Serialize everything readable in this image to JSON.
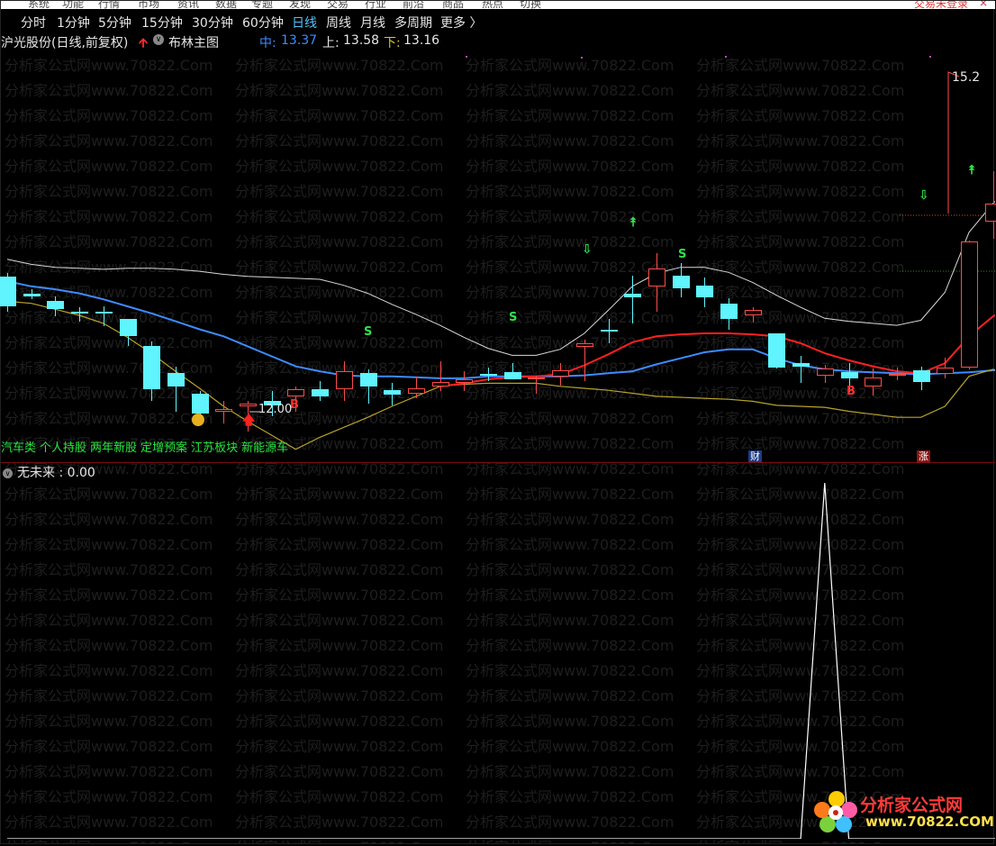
{
  "menu": [
    "系统",
    "功能",
    "行情",
    "市场",
    "资讯",
    "数据",
    "专题",
    "发现",
    "交易",
    "行业",
    "前沿",
    "商品",
    "热点",
    "切换"
  ],
  "login_status": "交易未登录",
  "close_label": "×",
  "periods": [
    {
      "label": "分时",
      "active": false
    },
    {
      "label": "1分钟",
      "active": false
    },
    {
      "label": "5分钟",
      "active": false
    },
    {
      "label": "15分钟",
      "active": false
    },
    {
      "label": "30分钟",
      "active": false
    },
    {
      "label": "60分钟",
      "active": false
    },
    {
      "label": "日线",
      "active": true
    },
    {
      "label": "周线",
      "active": false
    },
    {
      "label": "月线",
      "active": false
    },
    {
      "label": "多周期",
      "active": false
    },
    {
      "label": "更多 〉",
      "active": false
    }
  ],
  "info": {
    "stock_title": "沪光股份(日线,前复权)",
    "indicator_name": "布林主图",
    "mid_label": "中:",
    "mid_value": "13.37",
    "upper_label": "上:",
    "upper_value": "13.58",
    "lower_label": "下:",
    "lower_value": "13.16"
  },
  "price_annotations": {
    "low_price": "12.00",
    "high_price": "15.2"
  },
  "signal_marks": {
    "buy": "B",
    "sell": "S"
  },
  "concept_tags": [
    "汽车类",
    "个人持股",
    "两年新股",
    "定增预案",
    "江苏板块",
    "新能源车"
  ],
  "event_badges": {
    "finance": "财",
    "rise": "涨"
  },
  "sub_indicator": {
    "label": "无未来 : 0.00"
  },
  "watermark_text": "分析家公式网www.70822.Com",
  "logo": {
    "title": "分析家公式网",
    "url": "www.70822.COM"
  },
  "colors": {
    "up": "#ff4b4b",
    "down": "#5ff4ff",
    "mid_line": "#3d8cff",
    "upper_line": "#d9d9d9",
    "lower_line": "#b8a22a",
    "ma_red": "#ff2020",
    "active_period": "#4fc3ff"
  },
  "chart_data": {
    "type": "candlestick",
    "visible_price_labels": [
      "12.00",
      "15.2"
    ],
    "candles_ohlc": [
      [
        13.55,
        13.58,
        13.2,
        13.25
      ],
      [
        13.38,
        13.42,
        13.32,
        13.35
      ],
      [
        13.3,
        13.35,
        13.15,
        13.22
      ],
      [
        13.2,
        13.24,
        13.1,
        13.18
      ],
      [
        13.2,
        13.25,
        13.05,
        13.18
      ],
      [
        13.12,
        13.12,
        12.85,
        12.95
      ],
      [
        12.85,
        12.9,
        12.3,
        12.42
      ],
      [
        12.58,
        12.65,
        12.2,
        12.45
      ],
      [
        12.38,
        12.4,
        12.12,
        12.18
      ],
      [
        12.2,
        12.3,
        12.08,
        12.22
      ],
      [
        12.25,
        12.3,
        12.0,
        12.28
      ],
      [
        12.3,
        12.4,
        12.15,
        12.26
      ],
      [
        12.35,
        12.45,
        12.2,
        12.42
      ],
      [
        12.42,
        12.5,
        12.3,
        12.35
      ],
      [
        12.42,
        12.7,
        12.3,
        12.6
      ],
      [
        12.58,
        12.62,
        12.28,
        12.45
      ],
      [
        12.41,
        12.48,
        12.26,
        12.37
      ],
      [
        12.38,
        12.55,
        12.33,
        12.43
      ],
      [
        12.45,
        12.7,
        12.4,
        12.49
      ],
      [
        12.48,
        12.6,
        12.4,
        12.52
      ],
      [
        12.57,
        12.64,
        12.5,
        12.56
      ],
      [
        12.59,
        12.68,
        12.52,
        12.52
      ],
      [
        12.52,
        12.56,
        12.38,
        12.54
      ],
      [
        12.55,
        12.68,
        12.46,
        12.61
      ],
      [
        12.84,
        12.92,
        12.5,
        12.88
      ],
      [
        13.02,
        13.12,
        12.88,
        13.0
      ],
      [
        13.38,
        13.56,
        13.08,
        13.34
      ],
      [
        13.45,
        13.78,
        13.2,
        13.63
      ],
      [
        13.56,
        13.68,
        13.34,
        13.43
      ],
      [
        13.46,
        13.54,
        13.24,
        13.34
      ],
      [
        13.28,
        13.33,
        13.02,
        13.12
      ],
      [
        13.16,
        13.24,
        13.09,
        13.21
      ],
      [
        12.98,
        12.98,
        12.63,
        12.64
      ],
      [
        12.68,
        12.75,
        12.48,
        12.65
      ],
      [
        12.56,
        12.66,
        12.48,
        12.63
      ],
      [
        12.59,
        12.68,
        12.39,
        12.53
      ],
      [
        12.45,
        12.63,
        12.36,
        12.54
      ],
      [
        12.57,
        12.64,
        12.51,
        12.57
      ],
      [
        12.61,
        12.65,
        12.41,
        12.49
      ],
      [
        12.57,
        12.74,
        12.53,
        12.64
      ],
      [
        12.64,
        13.91,
        12.62,
        13.9
      ],
      [
        14.1,
        14.6,
        13.93,
        14.28
      ],
      [
        14.2,
        14.3,
        13.9,
        14.22
      ]
    ],
    "series": [
      {
        "name": "上",
        "values": [
          13.72,
          13.67,
          13.64,
          13.63,
          13.62,
          13.63,
          13.63,
          13.62,
          13.6,
          13.57,
          13.55,
          13.54,
          13.53,
          13.52,
          13.46,
          13.38,
          13.27,
          13.17,
          13.06,
          12.94,
          12.83,
          12.76,
          12.76,
          12.82,
          12.98,
          13.21,
          13.45,
          13.58,
          13.64,
          13.64,
          13.59,
          13.49,
          13.36,
          13.24,
          13.13,
          13.1,
          13.08,
          13.06,
          13.11,
          13.39,
          13.99,
          14.28,
          14.5
        ]
      },
      {
        "name": "中",
        "values": [
          13.5,
          13.45,
          13.42,
          13.38,
          13.32,
          13.25,
          13.18,
          13.1,
          13.02,
          12.95,
          12.85,
          12.75,
          12.65,
          12.6,
          12.56,
          12.55,
          12.55,
          12.54,
          12.53,
          12.53,
          12.55,
          12.55,
          12.55,
          12.55,
          12.56,
          12.58,
          12.6,
          12.67,
          12.73,
          12.79,
          12.82,
          12.82,
          12.73,
          12.66,
          12.62,
          12.6,
          12.59,
          12.58,
          12.57,
          12.58,
          12.59,
          12.61,
          12.62
        ]
      },
      {
        "name": "下",
        "values": [
          13.3,
          13.28,
          13.22,
          13.16,
          13.08,
          12.94,
          12.78,
          12.6,
          12.43,
          12.25,
          12.1,
          11.96,
          11.82,
          11.94,
          12.04,
          12.14,
          12.25,
          12.35,
          12.45,
          12.47,
          12.48,
          12.48,
          12.48,
          12.45,
          12.43,
          12.41,
          12.38,
          12.35,
          12.34,
          12.33,
          12.32,
          12.3,
          12.26,
          12.25,
          12.24,
          12.2,
          12.17,
          12.14,
          12.14,
          12.25,
          12.55,
          12.62,
          12.55
        ]
      },
      {
        "name": "MA",
        "values": [
          null,
          null,
          null,
          null,
          null,
          null,
          null,
          null,
          null,
          null,
          null,
          null,
          null,
          null,
          null,
          null,
          null,
          null,
          12.45,
          12.48,
          12.52,
          12.54,
          12.55,
          12.57,
          12.66,
          12.77,
          12.89,
          12.95,
          12.97,
          12.98,
          12.98,
          12.97,
          12.95,
          12.88,
          12.78,
          12.71,
          12.65,
          12.6,
          12.58,
          12.68,
          12.95,
          13.15,
          13.28
        ]
      }
    ],
    "sub_series": [
      {
        "values": [
          0,
          0,
          0,
          0,
          0,
          0,
          0,
          0,
          0,
          0,
          0,
          0,
          0,
          0,
          0,
          0,
          0,
          0,
          0,
          0,
          0,
          0,
          0,
          0,
          0,
          0,
          0,
          0,
          0,
          0,
          0,
          0,
          0,
          0,
          1,
          0,
          0,
          0,
          0,
          0,
          0,
          0,
          0
        ]
      }
    ],
    "ylim": [
      11.7,
      15.8
    ]
  }
}
